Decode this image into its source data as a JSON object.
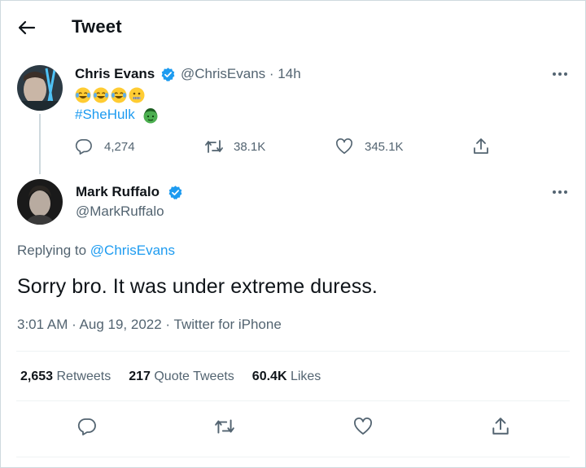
{
  "header": {
    "title": "Tweet",
    "back_icon": "arrow-left-icon"
  },
  "parent_tweet": {
    "author_name": "Chris Evans",
    "author_handle": "@ChrisEvans",
    "time": "14h",
    "emojis": [
      "face-with-tears-of-joy",
      "face-with-tears-of-joy",
      "face-with-tears-of-joy",
      "zipper-mouth-face"
    ],
    "hashtag": "#SheHulk",
    "replies": "4,274",
    "retweets": "38.1K",
    "likes": "345.1K"
  },
  "main_tweet": {
    "author_name": "Mark Ruffalo",
    "author_handle": "@MarkRuffalo",
    "replying_to_label": "Replying to",
    "replying_to_handle": "@ChrisEvans",
    "text": "Sorry bro. It was under extreme duress.",
    "time": "3:01 AM",
    "date": "Aug 19, 2022",
    "source": "Twitter for iPhone",
    "retweets_count": "2,653",
    "retweets_label": "Retweets",
    "quote_count": "217",
    "quote_label": "Quote Tweets",
    "likes_count": "60.4K",
    "likes_label": "Likes"
  },
  "colors": {
    "accent": "#1d9bf0",
    "text_primary": "#0f1419",
    "text_secondary": "#536471",
    "border": "#eff3f4"
  }
}
